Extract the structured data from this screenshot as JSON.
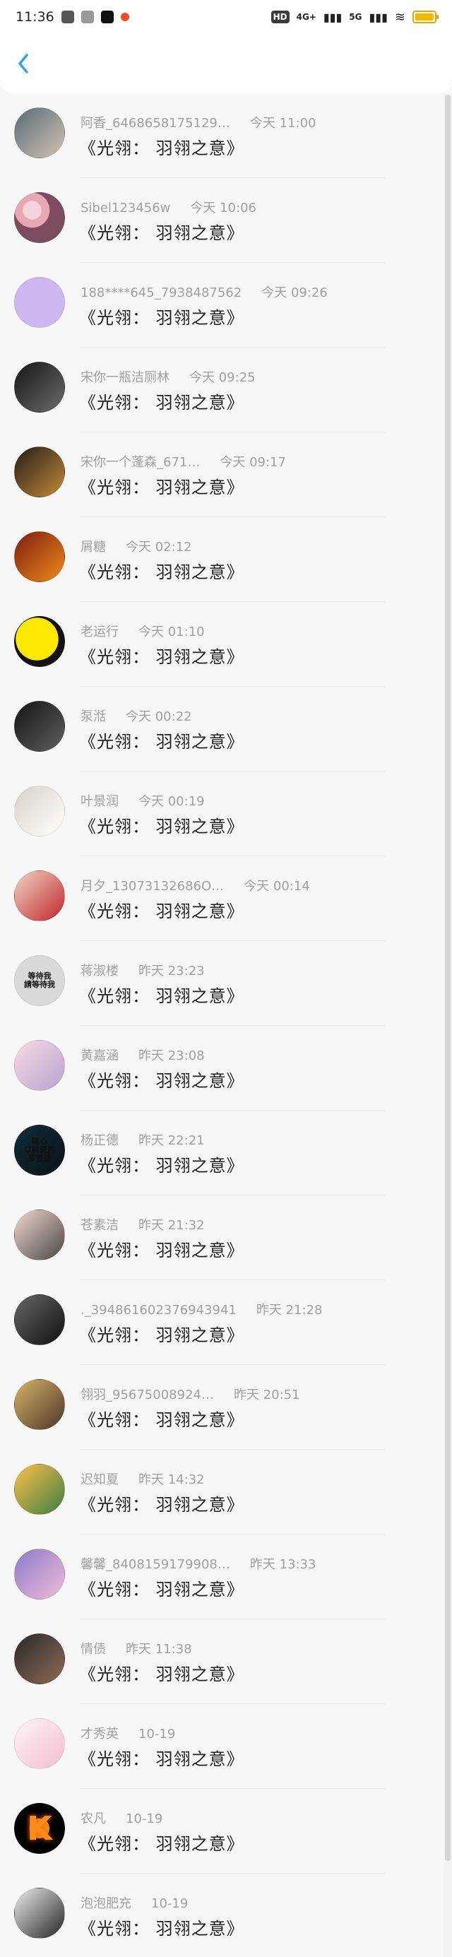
{
  "status": {
    "time": "11:36",
    "network_1": "4G+",
    "network_2": "5G"
  },
  "header": {
    "back_icon": "chevron-left-icon",
    "accent": "#2aa7e6"
  },
  "messages": [
    {
      "name": "阿香_6468658175129…",
      "time": "今天 11:00",
      "text": "《光翎： 羽翎之意》",
      "avatar": {
        "bg": "linear-gradient(135deg,#5b6b74,#d0c3b6)",
        "label": ""
      }
    },
    {
      "name": "Sibel123456w",
      "time": "今天 10:06",
      "text": "《光翎： 羽翎之意》",
      "avatar": {
        "bg": "radial-gradient(circle at 35% 35%,#f5d3dc 0 20%,#e7a7b4 21% 38%,#7d4d5f 39% 100%)",
        "label": ""
      }
    },
    {
      "name": "188****645_7938487562",
      "time": "今天 09:26",
      "text": "《光翎： 羽翎之意》",
      "avatar": {
        "bg": "#cdb9ef",
        "label": ""
      }
    },
    {
      "name": "宋你一瓶洁厕林",
      "time": "今天 09:25",
      "text": "《光翎： 羽翎之意》",
      "avatar": {
        "bg": "linear-gradient(135deg,#161616,#6b6b6b)",
        "label": ""
      }
    },
    {
      "name": "宋你一个蓬森_671…",
      "time": "今天 09:17",
      "text": "《光翎： 羽翎之意》",
      "avatar": {
        "bg": "linear-gradient(135deg,#241b18,#c38c38)",
        "label": ""
      }
    },
    {
      "name": "屑糖",
      "time": "今天 02:12",
      "text": "《光翎： 羽翎之意》",
      "avatar": {
        "bg": "linear-gradient(135deg,#7b1d12,#f08b1a)",
        "label": ""
      }
    },
    {
      "name": "老运行",
      "time": "今天 01:10",
      "text": "《光翎： 羽翎之意》",
      "avatar": {
        "bg": "radial-gradient(circle at 45% 45%,#ffe800 0 55%,#111 56% 100%)",
        "label": ""
      }
    },
    {
      "name": "泵湉",
      "time": "今天 00:22",
      "text": "《光翎： 羽翎之意》",
      "avatar": {
        "bg": "linear-gradient(135deg,#151515,#5e5e5e)",
        "label": ""
      }
    },
    {
      "name": "叶景润",
      "time": "今天 00:19",
      "text": "《光翎： 羽翎之意》",
      "avatar": {
        "bg": "linear-gradient(135deg,#d8d2c8,#ffffff)",
        "label": ""
      }
    },
    {
      "name": "月夕_13073132686O…",
      "time": "今天 00:14",
      "text": "《光翎： 羽翎之意》",
      "avatar": {
        "bg": "linear-gradient(135deg,#f0d5c5,#c0262c)",
        "label": ""
      }
    },
    {
      "name": "蒋淑楼",
      "time": "昨天 23:23",
      "text": "《光翎： 羽翎之意》",
      "avatar": {
        "bg": "#d9d9d9",
        "label": "等待我\n請等待我"
      }
    },
    {
      "name": "黄嘉涵",
      "time": "昨天 23:08",
      "text": "《光翎： 羽翎之意》",
      "avatar": {
        "bg": "linear-gradient(135deg,#f8dbe7,#b8a3cc)",
        "label": ""
      }
    },
    {
      "name": "杨正德",
      "time": "昨天 22:21",
      "text": "《光翎： 羽翎之意》",
      "avatar": {
        "bg": "linear-gradient(135deg,#102b36,#0d1217)",
        "label": "随心\n以前说的\n那些话"
      }
    },
    {
      "name": "苍素洁",
      "time": "昨天 21:32",
      "text": "《光翎： 羽翎之意》",
      "avatar": {
        "bg": "linear-gradient(135deg,#f2d7cf,#474747)",
        "label": ""
      }
    },
    {
      "name": "._3948616023769439​41",
      "time": "昨天 21:28",
      "text": "《光翎： 羽翎之意》",
      "avatar": {
        "bg": "linear-gradient(135deg,#666,#111)",
        "label": ""
      }
    },
    {
      "name": "翎羽_95675008924…",
      "time": "昨天 20:51",
      "text": "《光翎： 羽翎之意》",
      "avatar": {
        "bg": "linear-gradient(135deg,#d5b46b,#4e3627)",
        "label": ""
      }
    },
    {
      "name": "迟知夏",
      "time": "昨天 14:32",
      "text": "《光翎： 羽翎之意》",
      "avatar": {
        "bg": "linear-gradient(135deg,#ffbf4a,#3c7f44)",
        "label": ""
      }
    },
    {
      "name": "馨馨_8408159179908…",
      "time": "昨天 13:33",
      "text": "《光翎： 羽翎之意》",
      "avatar": {
        "bg": "linear-gradient(135deg,#8b7ac9,#f0bdd7)",
        "label": ""
      }
    },
    {
      "name": "情债",
      "time": "昨天 11:38",
      "text": "《光翎： 羽翎之意》",
      "avatar": {
        "bg": "linear-gradient(135deg,#2a2a2a,#8d6b56)",
        "label": ""
      }
    },
    {
      "name": "才秀英",
      "time": "10-19",
      "text": "《光翎： 羽翎之意》",
      "avatar": {
        "bg": "linear-gradient(135deg,#fff3f6,#f1bfd2)",
        "label": ""
      }
    },
    {
      "name": "农凡",
      "time": "10-19",
      "text": "《光翎： 羽翎之意》",
      "avatar": {
        "bg": "radial-gradient(circle at 50% 50%,#f28a1a 0 28%,#000 29% 100%)",
        "label": "K"
      }
    },
    {
      "name": "泡泡肥充",
      "time": "10-19",
      "text": "《光翎： 羽翎之意》",
      "avatar": {
        "bg": "linear-gradient(135deg,#ececec,#262626)",
        "label": ""
      }
    }
  ]
}
